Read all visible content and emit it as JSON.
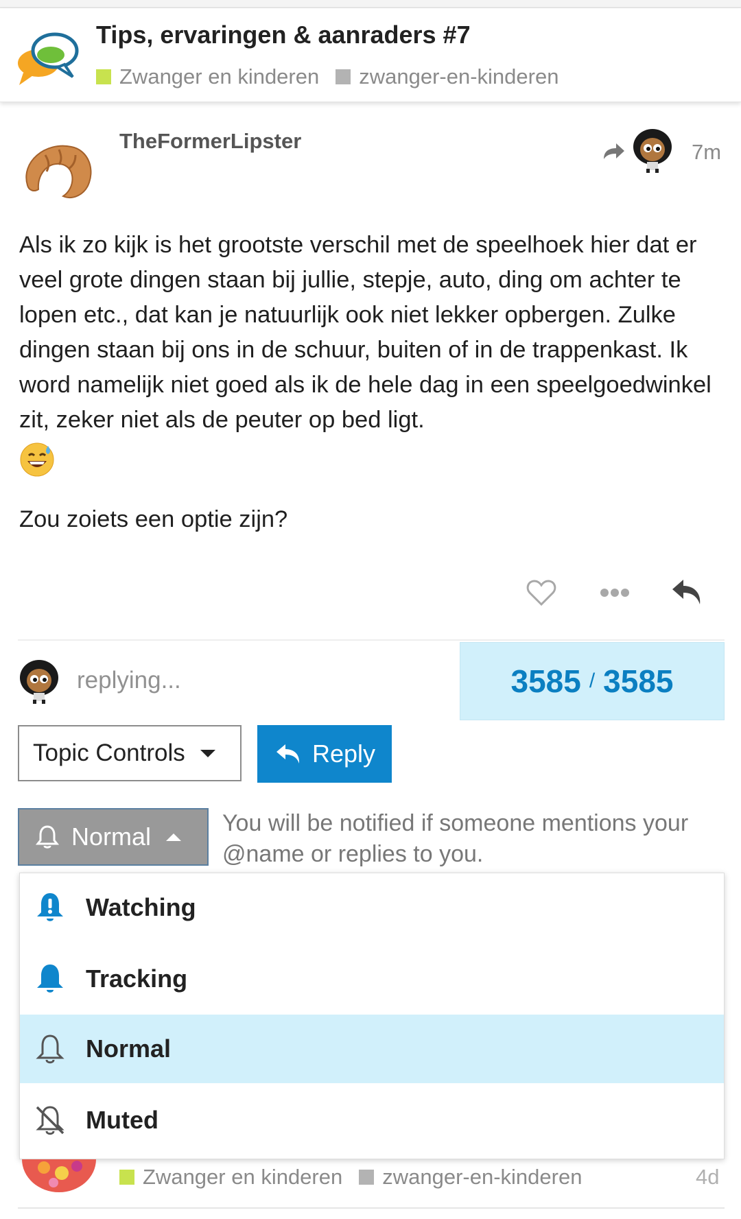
{
  "topic": {
    "title": "Tips, ervaringen & aanraders #7",
    "category": "Zwanger en kinderen",
    "tag": "zwanger-en-kinderen"
  },
  "post": {
    "username": "TheFormerLipster",
    "time": "7m",
    "body": "Als ik zo kijk is het grootste verschil met de speelhoek hier dat er veel grote dingen staan bij jullie, stepje, auto, ding om achter te lopen etc., dat kan je natuurlijk ook niet lekker opbergen. Zulke dingen staan bij ons in de schuur, buiten of in de trappenkast. Ik word namelijk niet goed als ik de hele dag in een speelgoedwinkel zit, zeker niet als de peuter op bed ligt.",
    "body2": "Zou zoiets een optie zijn?"
  },
  "status": {
    "replying": "replying...",
    "progress_current": "3585",
    "progress_separator": "/",
    "progress_total": "3585"
  },
  "buttons": {
    "topic_controls": "Topic Controls",
    "reply": "Reply"
  },
  "notifications": {
    "current": "Normal",
    "description": "You will be notified if someone mentions your @name or replies to you.",
    "options": [
      {
        "label": "Watching",
        "icon": "bell-exclamation-icon"
      },
      {
        "label": "Tracking",
        "icon": "bell-filled-icon"
      },
      {
        "label": "Normal",
        "icon": "bell-outline-icon",
        "selected": true
      },
      {
        "label": "Muted",
        "icon": "bell-slash-icon"
      }
    ]
  },
  "next_topic": {
    "category": "Zwanger en kinderen",
    "tag": "zwanger-en-kinderen",
    "age": "4d"
  },
  "colors": {
    "accent": "#0f86cc",
    "highlight": "#d1f0fb",
    "category_square": "#c8e24e",
    "tag_square": "#b3b3b3",
    "notif_button": "#999999"
  }
}
